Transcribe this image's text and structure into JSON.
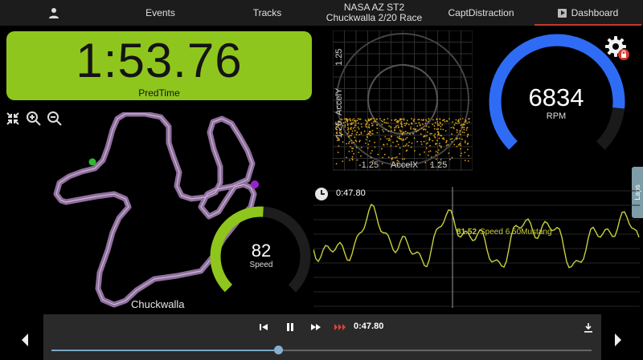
{
  "nav": {
    "tabs": [
      {
        "label": "Events"
      },
      {
        "label": "Tracks"
      },
      {
        "label_line1": "NASA AZ ST2",
        "label_line2": "Chuckwalla 2/20 Race"
      },
      {
        "label": "CaptDistraction"
      },
      {
        "label": "Dashboard",
        "active": true
      }
    ]
  },
  "laptime": {
    "value": "1:53.76",
    "label": "PredTime"
  },
  "map": {
    "track_name": "Chuckwalla"
  },
  "speed": {
    "value": "82",
    "label": "Speed",
    "max": 160,
    "color": "#8fc61d"
  },
  "accel": {
    "ylabel": "AccelY",
    "xlabel": "AccelX",
    "y_top": "1.25",
    "y_bottom": "-1.25",
    "x_left": "-1.25",
    "x_right": "1.25"
  },
  "rpm": {
    "value": "6834",
    "label": "RPM",
    "max": 8000,
    "color": "#2f6cf5"
  },
  "laps_tab": {
    "label": "Laps"
  },
  "timeseries": {
    "time": "0:47.80",
    "cursor_value": "81.52",
    "series_name": "Speed 6.50Mustang",
    "color": "#c8cf3a"
  },
  "player": {
    "time": "0:47.80",
    "progress": 0.42
  },
  "colors": {
    "accent": "#8fc61d",
    "rpm": "#2f6cf5",
    "active_tab": "#c0392b"
  }
}
